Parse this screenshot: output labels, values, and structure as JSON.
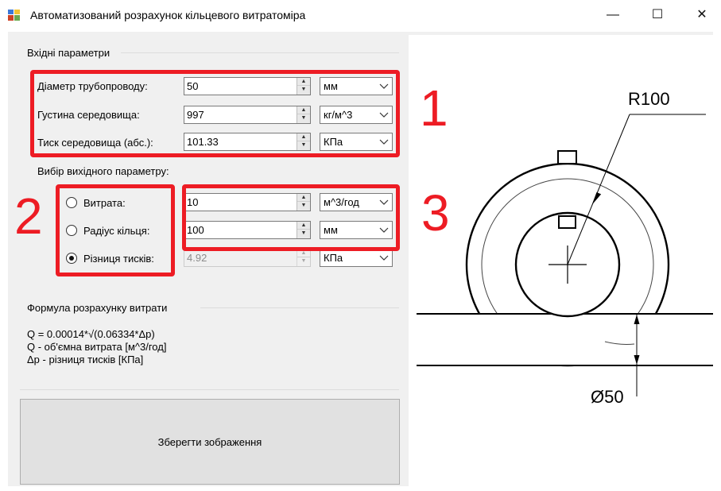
{
  "window": {
    "title": "Автоматизований розрахунок кільцевого витратоміра",
    "controls": {
      "minimize": "—",
      "maximize": "☐",
      "close": "✕"
    }
  },
  "input_group": {
    "title": "Вхідні параметри",
    "rows": [
      {
        "label": "Діаметр трубопроводу:",
        "value": "50",
        "unit": "мм"
      },
      {
        "label": "Густина середовища:",
        "value": "997",
        "unit": "кг/м^3"
      },
      {
        "label": "Тиск середовища (абс.):",
        "value": "101.33",
        "unit": "КПа"
      }
    ]
  },
  "output_group": {
    "title": "Вибір вихідного параметру:",
    "rows": [
      {
        "label": "Витрата:",
        "value": "10",
        "unit": "м^3/год",
        "selected": false,
        "enabled": true
      },
      {
        "label": "Радіус кільця:",
        "value": "100",
        "unit": "мм",
        "selected": false,
        "enabled": true
      },
      {
        "label": "Різниця тисків:",
        "value": "4.92",
        "unit": "КПа",
        "selected": true,
        "enabled": false
      }
    ]
  },
  "formula_group": {
    "title": "Формула розрахунку витрати",
    "lines": [
      "Q = 0.00014*√(0.06334*Δp)",
      "Q - об'ємна витрата [м^3/год]",
      "Δp - різниця тисків [КПа]"
    ]
  },
  "save_button": {
    "label": "Зберегти зображення"
  },
  "annotations": {
    "marker1": "1",
    "marker2": "2",
    "marker3": "3",
    "color": "#ed1c24"
  },
  "drawing": {
    "radius_label": "R100",
    "diameter_label": "Ø50"
  },
  "icons": {
    "app": "app-window-icon",
    "spin": "updown-arrows-icon",
    "combo": "chevron-down-icon"
  }
}
